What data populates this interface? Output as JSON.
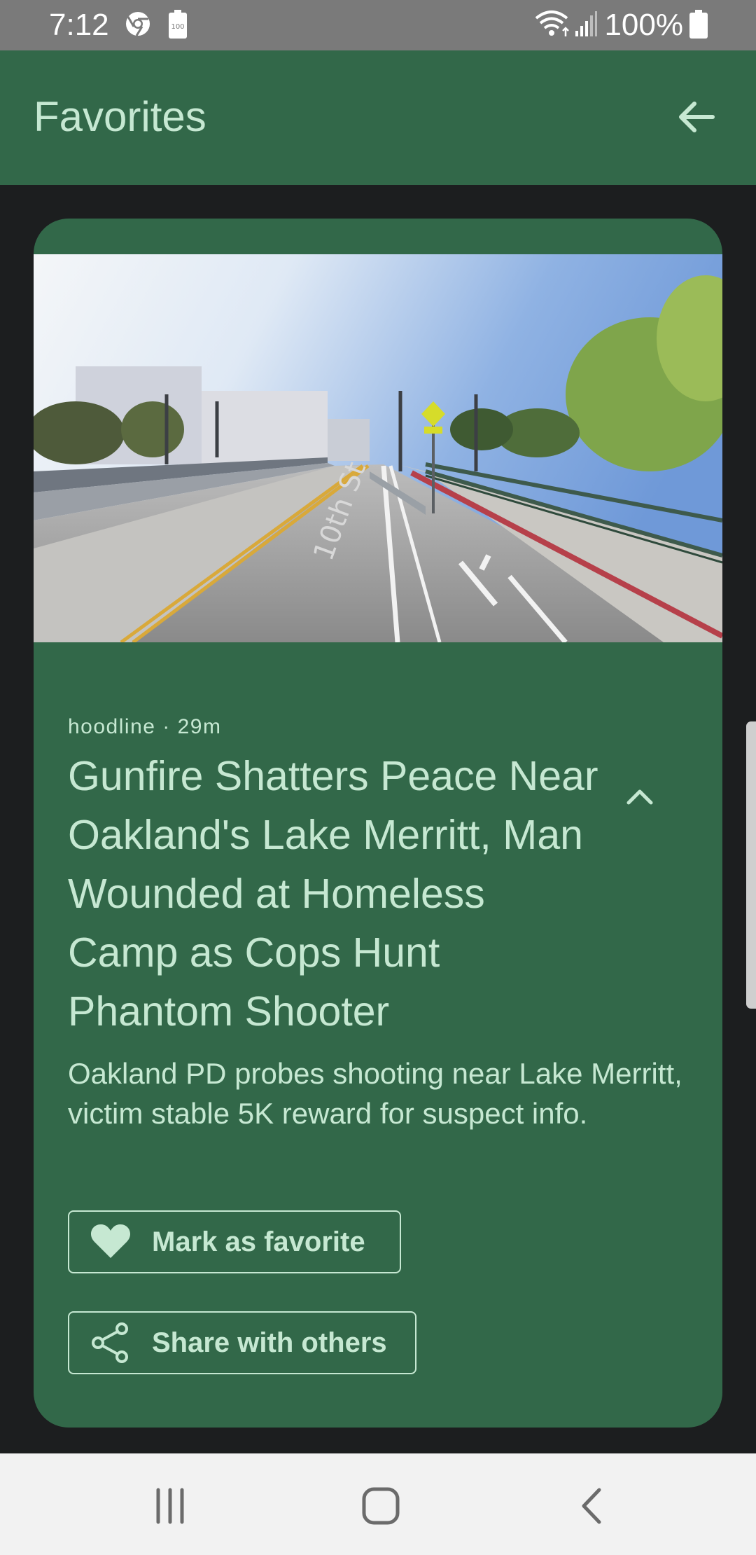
{
  "status_bar": {
    "time": "7:12",
    "battery_percent": "100%",
    "icons": [
      "chrome-icon",
      "battery-saver-icon",
      "wifi-icon",
      "signal-icon",
      "battery-icon"
    ]
  },
  "app_bar": {
    "title": "Favorites",
    "back_icon": "arrow-back-icon"
  },
  "article": {
    "image_description": "street view photo",
    "source_time": "hoodline · 29m",
    "headline": "Gunfire Shatters Peace Near Oakland's Lake Merritt, Man Wounded at Homeless Camp as Cops Hunt Phantom Shooter",
    "summary": "Oakland PD probes shooting near Lake Merritt, victim stable 5K reward for suspect info.",
    "collapse_icon": "chevron-up-icon",
    "favorite_label": "Mark as favorite",
    "favorite_icon": "heart-icon",
    "share_label": "Share with others",
    "share_icon": "share-icon"
  },
  "colors": {
    "primary": "#326849",
    "on_primary": "#c6e8d2",
    "background": "#1c1e1f",
    "status_bar": "#7a7a7a",
    "nav_bar": "#f2f2f2"
  },
  "nav_bar": {
    "icons": [
      "recent-apps-icon",
      "home-icon",
      "back-icon"
    ]
  }
}
